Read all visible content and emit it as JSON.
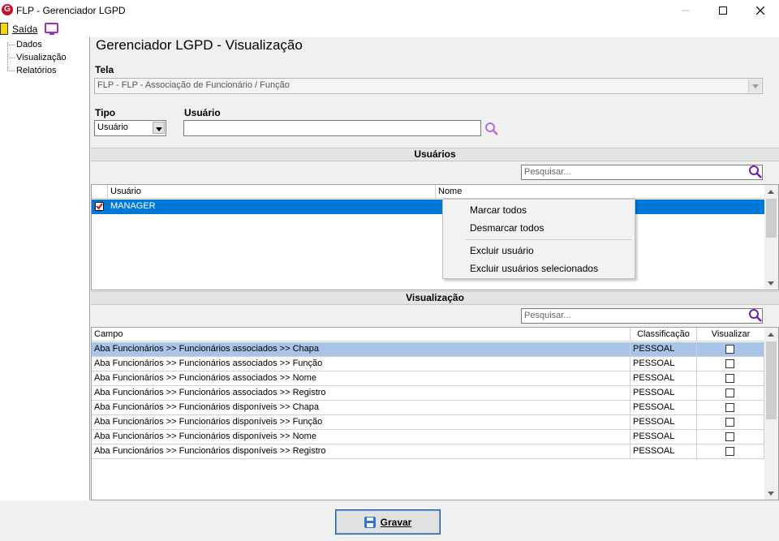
{
  "window": {
    "title": "FLP - Gerenciador LGPD",
    "app_icon": "G"
  },
  "menu": {
    "exit_label": "Saída",
    "icons": [
      "exit-icon",
      "screen-icon"
    ]
  },
  "sidebar": {
    "items": [
      {
        "label": "Dados"
      },
      {
        "label": "Visualização"
      },
      {
        "label": "Relatórios"
      }
    ]
  },
  "main": {
    "title": "Gerenciador LGPD - Visualização",
    "tela": {
      "label": "Tela",
      "value": "FLP - FLP - Associação de Funcionário / Função"
    },
    "tipo": {
      "label": "Tipo",
      "value": "Usuário"
    },
    "usuario": {
      "label": "Usuário",
      "value": ""
    }
  },
  "users_section": {
    "title": "Usuários",
    "search_placeholder": "Pesquisar...",
    "columns": [
      "Usuário",
      "Nome"
    ],
    "rows": [
      {
        "checked": true,
        "usuario": "MANAGER",
        "nome": ""
      }
    ],
    "selected_color": "#0078d7"
  },
  "context_menu": {
    "items": [
      "Marcar todos",
      "Desmarcar todos",
      "Excluir usuário",
      "Excluir usuários selecionados"
    ]
  },
  "view_section": {
    "title": "Visualização",
    "search_placeholder": "Pesquisar...",
    "columns": [
      "Campo",
      "Classificação",
      "Visualizar"
    ],
    "rows": [
      {
        "campo": "Aba Funcionários >> Funcionários associados >> Chapa",
        "classificacao": "PESSOAL",
        "visualizar": false
      },
      {
        "campo": "Aba Funcionários >> Funcionários associados >> Função",
        "classificacao": "PESSOAL",
        "visualizar": false
      },
      {
        "campo": "Aba Funcionários >> Funcionários associados >> Nome",
        "classificacao": "PESSOAL",
        "visualizar": false
      },
      {
        "campo": "Aba Funcionários >> Funcionários associados >> Registro",
        "classificacao": "PESSOAL",
        "visualizar": false
      },
      {
        "campo": "Aba Funcionários >> Funcionários disponíveis >> Chapa",
        "classificacao": "PESSOAL",
        "visualizar": false
      },
      {
        "campo": "Aba Funcionários >> Funcionários disponíveis >> Função",
        "classificacao": "PESSOAL",
        "visualizar": false
      },
      {
        "campo": "Aba Funcionários >> Funcionários disponíveis >> Nome",
        "classificacao": "PESSOAL",
        "visualizar": false
      },
      {
        "campo": "Aba Funcionários >> Funcionários disponíveis >> Registro",
        "classificacao": "PESSOAL",
        "visualizar": false
      }
    ],
    "highlight_color": "#a8c4e8"
  },
  "footer": {
    "save_label": "Gravar"
  }
}
